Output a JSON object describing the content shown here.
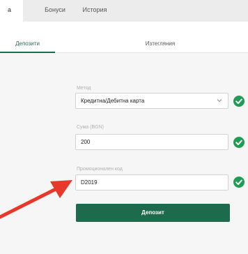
{
  "top_tabs": [
    {
      "label": "а"
    },
    {
      "label": "Бонуси"
    },
    {
      "label": "История"
    }
  ],
  "sub_tabs": {
    "deposit_label": "Депозити",
    "withdraw_label": "Изтегляния"
  },
  "form": {
    "method": {
      "label": "Метод",
      "value": "Кредитна/Дебитна карта"
    },
    "amount": {
      "label": "Сума (BGN)",
      "value": "200"
    },
    "promo": {
      "label": "Промоционален код",
      "value": "D2019"
    },
    "submit_label": "Депозит"
  },
  "colors": {
    "accent": "#1e6a4c",
    "check": "#1f9d55",
    "arrow": "#e8382a"
  },
  "icons": {
    "chevron": "chevron-down-icon",
    "check": "check-circle-icon",
    "arrow": "annotation-arrow"
  }
}
